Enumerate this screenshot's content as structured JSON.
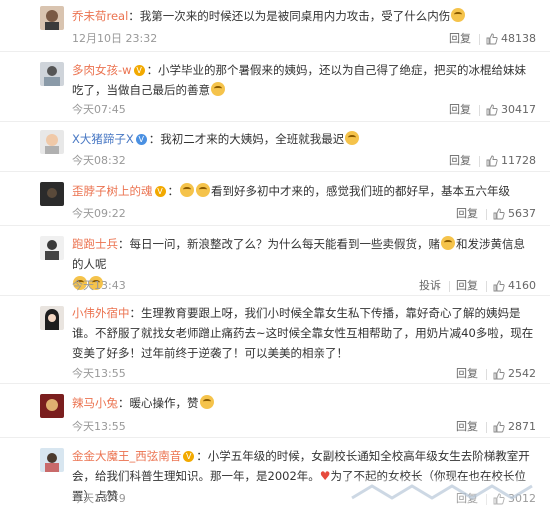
{
  "comments": [
    {
      "user": "乔未荀real",
      "text_before": "：我第一次来的时候还以为是被同桌用内力攻击，受了什么内伤",
      "text_after": "",
      "time": "12月10日 23:32",
      "reply_label": "回复",
      "likes": "48138"
    },
    {
      "user": "多肉女孩-w",
      "text_before": "：小学毕业的那个暑假来的姨妈，还以为自己得了绝症，把买的冰棍给妹妹吃了，当做自己最后的善意",
      "text_after": "",
      "time": "今天07:45",
      "reply_label": "回复",
      "likes": "30417"
    },
    {
      "user": "X大猪蹄子X",
      "text_before": "：我初二才来的大姨妈，全班就我最迟",
      "text_after": "",
      "time": "今天08:32",
      "reply_label": "回复",
      "likes": "11728"
    },
    {
      "user": "歪脖子树上的魂",
      "text_before": "：",
      "text_after": "看到好多初中才来的，感觉我们班的都好早，基本五六年级",
      "time": "今天09:22",
      "reply_label": "回复",
      "likes": "5637"
    },
    {
      "user": "跑跑士兵",
      "text_before": "：每日一问，新浪整改了么？为什么每天能看到一些卖假货，赌",
      "text_middle": "和发涉黄信息的人呢",
      "text_after": "",
      "time": "今天13:43",
      "report_label": "投诉",
      "reply_label": "回复",
      "likes": "4160"
    },
    {
      "user": "小伟外宿中",
      "text_before": "：生理教育要跟上呀，我们小时候全靠女生私下传播，靠好奇心了解的姨妈是谁。不舒服了就找女老师蹭止痛药去~这时候全靠女性互相帮助了，用奶片减40多啦，现在变美了好多！过年前终于逆袭了！可以美美的相亲了！",
      "text_after": "",
      "time": "今天13:55",
      "reply_label": "回复",
      "likes": "2542"
    },
    {
      "user": "辣马小兔",
      "text_before": "：暖心操作，赞",
      "text_after": "",
      "time": "今天13:55",
      "reply_label": "回复",
      "likes": "2871"
    },
    {
      "user": "金金大魔王_西弦南音",
      "text_before": "：小学五年级的时候，女副校长通知全校高年级女生去阶梯教室开会，给我们科普生理知识。那一年，是2002年。",
      "text_middle": "为了不起的女校长（你现在也在校长位置）点赞",
      "text_after": "",
      "time": "今天13:49",
      "reply_label": "回复",
      "likes": "3012"
    }
  ],
  "icons": {
    "like": "thumbs-up-icon",
    "vip": "vip-badge-icon",
    "emoji": "emoji-icon"
  },
  "colors": {
    "username": "#eb7350",
    "meta": "#999999",
    "divider": "#eeeeee"
  }
}
